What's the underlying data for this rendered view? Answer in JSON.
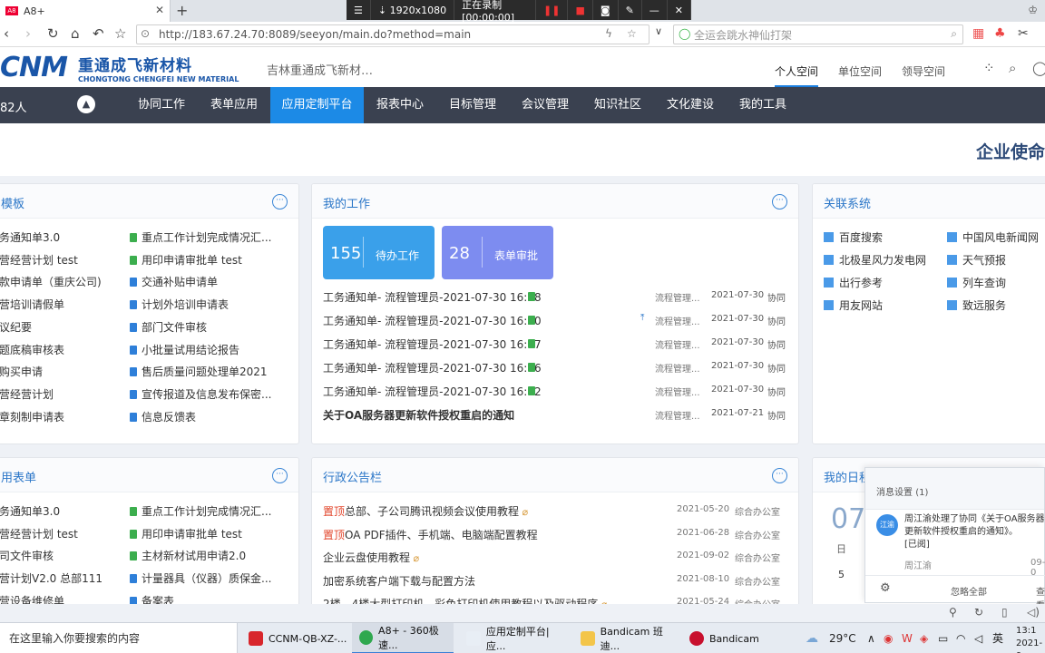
{
  "browser": {
    "tab_title": "A8+",
    "url": "http://183.67.24.70:8089/seeyon/main.do?method=main",
    "search_placeholder": "全运会跳水神仙打架"
  },
  "recorder": {
    "resolution": "1920x1080",
    "status": "正在录制 [00:00:00]"
  },
  "header": {
    "logo_big": "CNM",
    "logo_cn": "重通成飞新材料",
    "logo_en": "CHONGTONG CHENGFEI NEW MATERIAL",
    "company": "吉林重通成飞新材…",
    "spaces": [
      "个人空间",
      "单位空间",
      "领导空间"
    ]
  },
  "nav": {
    "count": "82人",
    "items": [
      "协同工作",
      "表单应用",
      "应用定制平台",
      "报表中心",
      "目标管理",
      "会议管理",
      "知识社区",
      "文化建设",
      "我的工具"
    ],
    "active_index": 2
  },
  "banner": {
    "mission": "企业使命"
  },
  "panel_template": {
    "title": "模板",
    "left": [
      "务通知单3.0",
      "营经营计划 test",
      "款申请单（重庆公司)",
      "营培训请假单",
      "议纪要",
      "题底稿审核表",
      "购买申请",
      "营经营计划",
      "章刻制申请表"
    ],
    "right": [
      "重点工作计划完成情况汇...",
      "用印申请审批单 test",
      "交通补贴申请单",
      "计划外培训申请表",
      "部门文件审核",
      "小批量试用结论报告",
      "售后质量问题处理单2021",
      "宣传报道及信息发布保密...",
      "信息反馈表"
    ],
    "right_colors": [
      "g",
      "g",
      "b",
      "b",
      "b",
      "b",
      "b",
      "b",
      "b"
    ]
  },
  "panel_work": {
    "title": "我的工作",
    "tiles": [
      {
        "num": "155",
        "label": "待办工作"
      },
      {
        "num": "28",
        "label": "表单审批"
      }
    ],
    "rows": [
      {
        "title": "工务通知单- 流程管理员-2021-07-30 16:28",
        "sender": "流程管理...",
        "date": "2021-07-30",
        "cat": "协同",
        "pinned": false,
        "bold": false
      },
      {
        "title": "工务通知单- 流程管理员-2021-07-30 16:20",
        "sender": "流程管理...",
        "date": "2021-07-30",
        "cat": "协同",
        "pinned": true,
        "bold": false
      },
      {
        "title": "工务通知单- 流程管理员-2021-07-30 16:17",
        "sender": "流程管理...",
        "date": "2021-07-30",
        "cat": "协同",
        "pinned": false,
        "bold": false
      },
      {
        "title": "工务通知单- 流程管理员-2021-07-30 16:16",
        "sender": "流程管理...",
        "date": "2021-07-30",
        "cat": "协同",
        "pinned": false,
        "bold": false
      },
      {
        "title": "工务通知单- 流程管理员-2021-07-30 16:12",
        "sender": "流程管理...",
        "date": "2021-07-30",
        "cat": "协同",
        "pinned": false,
        "bold": false
      },
      {
        "title": "关于OA服务器更新软件授权重启的通知",
        "sender": "流程管理...",
        "date": "2021-07-21",
        "cat": "协同",
        "pinned": false,
        "bold": true
      }
    ]
  },
  "panel_links": {
    "title": "关联系统",
    "left": [
      "百度搜索",
      "北极星风力发电网",
      "出行参考",
      "用友网站"
    ],
    "right": [
      "中国风电新闻网",
      "天气预报",
      "列车查询",
      "致远服务"
    ]
  },
  "panel_forms": {
    "title": "用表单",
    "left": [
      "务通知单3.0",
      "营经营计划 test",
      "司文件审核",
      "营计划V2.0 总部111",
      "营设备维修单"
    ],
    "right": [
      "重点工作计划完成情况汇...",
      "用印申请审批单 test",
      "主材新材试用申请2.0",
      "计量器具（仪器）质保金...",
      "备案表"
    ],
    "right_colors": [
      "g",
      "g",
      "g",
      "b",
      "b"
    ]
  },
  "panel_notice": {
    "title": "行政公告栏",
    "top_tag": "置顶",
    "rows": [
      {
        "title": "总部、子公司腾讯视频会议使用教程",
        "date": "2021-05-20",
        "org": "综合办公室",
        "top": true,
        "clip": true
      },
      {
        "title": "OA PDF插件、手机端、电脑端配置教程",
        "date": "2021-06-28",
        "org": "综合办公室",
        "top": true,
        "clip": false
      },
      {
        "title": "企业云盘使用教程",
        "date": "2021-09-02",
        "org": "综合办公室",
        "top": false,
        "clip": true
      },
      {
        "title": "加密系统客户端下载与配置方法",
        "date": "2021-08-10",
        "org": "综合办公室",
        "top": false,
        "clip": false
      },
      {
        "title": "2楼、4楼大型打印机、彩色打印机使用教程以及驱动程序",
        "date": "2021-05-24",
        "org": "综合办公室",
        "top": false,
        "clip": true
      }
    ]
  },
  "panel_calendar": {
    "title": "我的日程",
    "big": "07",
    "day": "日",
    "n": "5"
  },
  "message": {
    "title": "消息设置",
    "count": "(1)",
    "avatar": "江渝",
    "text": "周江渝处理了协同《关于OA服务器更新软件授权重启的通知》。",
    "status": "[已阅]",
    "from": "周江渝",
    "date": "09-0",
    "ignore": "忽略全部",
    "view": "查看"
  },
  "taskbar": {
    "search": "在这里输入你要搜索的内容",
    "apps": [
      "CCNM-QB-XZ-...",
      "A8+ - 360极速...",
      "应用定制平台|应...",
      "Bandicam 班迪...",
      "Bandicam"
    ],
    "temp": "29°C",
    "ime": "英",
    "time": "13:1",
    "date": "2021-9"
  },
  "colors": {
    "nav_bg": "#3a4150",
    "nav_active": "#1c8ae6",
    "tile1": "#3aa0ea",
    "tile2": "#7d8cf0",
    "accent": "#2a76c8"
  }
}
